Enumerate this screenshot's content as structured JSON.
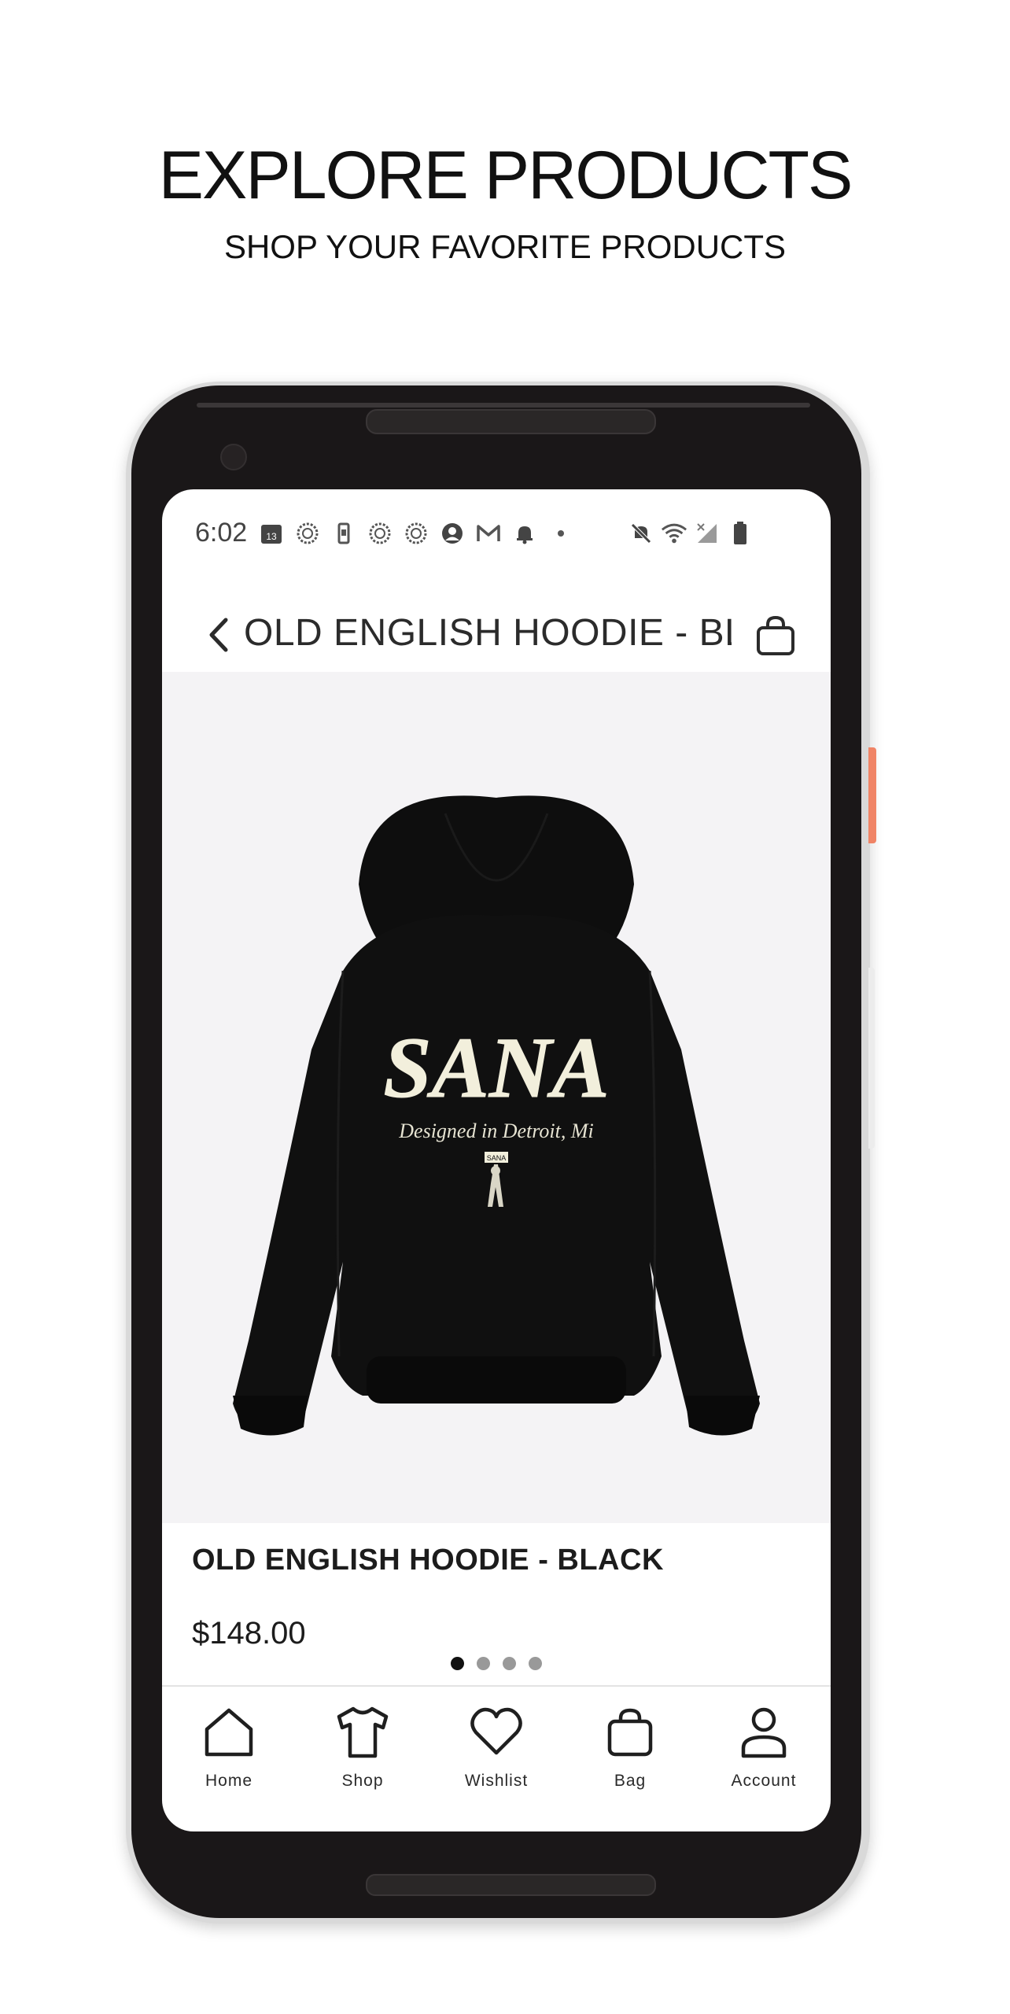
{
  "promo": {
    "title": "EXPLORE PRODUCTS",
    "subtitle": "SHOP YOUR FAVORITE PRODUCTS"
  },
  "status_bar": {
    "time": "6:02",
    "calendar_day": "13",
    "left_icons": [
      "calendar-icon",
      "sync-icon",
      "phone-icon",
      "sync-icon",
      "sync-icon",
      "account-circle-icon",
      "gmail-icon",
      "bell-icon",
      "dot-icon"
    ],
    "right_icons": [
      "mute-icon",
      "wifi-icon",
      "signal-icon",
      "battery-icon"
    ]
  },
  "nav": {
    "title": "OLD ENGLISH HOODIE - BLA...",
    "back_icon": "chevron-left-icon",
    "bag_icon": "shopping-bag-icon"
  },
  "product": {
    "image_text_main": "SANA",
    "image_text_script": "Designed in Detroit, Mi",
    "image_text_tag": "SANA",
    "carousel": {
      "count": 4,
      "active_index": 0
    },
    "name": "OLD ENGLISH HOODIE - BLACK",
    "price": "$148.00"
  },
  "tabs": [
    {
      "label": "Home",
      "icon": "home-icon"
    },
    {
      "label": "Shop",
      "icon": "tshirt-icon"
    },
    {
      "label": "Wishlist",
      "icon": "heart-icon"
    },
    {
      "label": "Bag",
      "icon": "shopping-bag-icon"
    },
    {
      "label": "Account",
      "icon": "user-icon"
    }
  ],
  "colors": {
    "phone_body": "#1a1718",
    "power_button": "#f08466",
    "image_background": "#f4f3f5",
    "text": "#1c1c1c"
  }
}
